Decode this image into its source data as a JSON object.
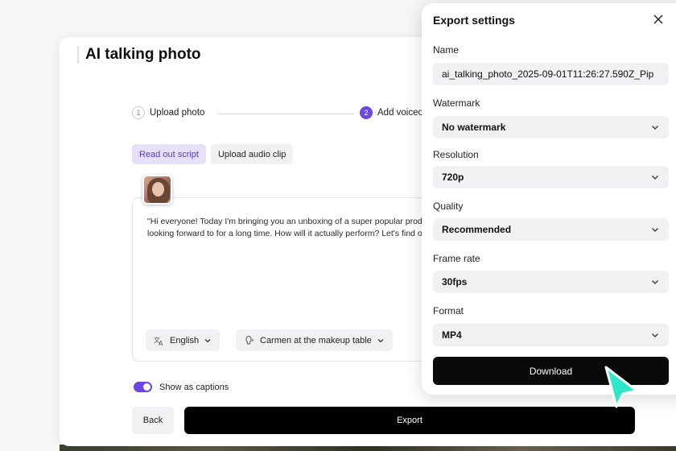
{
  "app": {
    "title": "AI talking photo",
    "steps": [
      {
        "number": "1",
        "label": "Upload photo"
      },
      {
        "number": "2",
        "label": "Add voiceo"
      }
    ],
    "tabs": [
      {
        "label": "Read out script",
        "active": true
      },
      {
        "label": "Upload audio clip",
        "active": false
      }
    ],
    "script_text": "\"Hi everyone! Today I'm bringing you an unboxing of a super popular product I've been looking forward to for a long time. How will it actually perform? Let's find out!\"",
    "language": {
      "label": "English",
      "icon": "translate-icon"
    },
    "voice": {
      "label": "Carmen at the makeup table",
      "icon": "voice-icon"
    },
    "captions": {
      "label": "Show as captions",
      "enabled": true
    },
    "back_label": "Back",
    "export_label": "Export"
  },
  "export_panel": {
    "title": "Export settings",
    "name_label": "Name",
    "name_value": "ai_talking_photo_2025-09-01T11:26:27.590Z_Pip",
    "watermark_label": "Watermark",
    "watermark_value": "No watermark",
    "resolution_label": "Resolution",
    "resolution_value": "720p",
    "quality_label": "Quality",
    "quality_value": "Recommended",
    "frame_rate_label": "Frame rate",
    "frame_rate_value": "30fps",
    "format_label": "Format",
    "format_value": "MP4",
    "download_label": "Download"
  },
  "colors": {
    "accent": "#6e46e0",
    "cursor": "#2ee6c8",
    "button_dark": "#0a0a0a"
  }
}
